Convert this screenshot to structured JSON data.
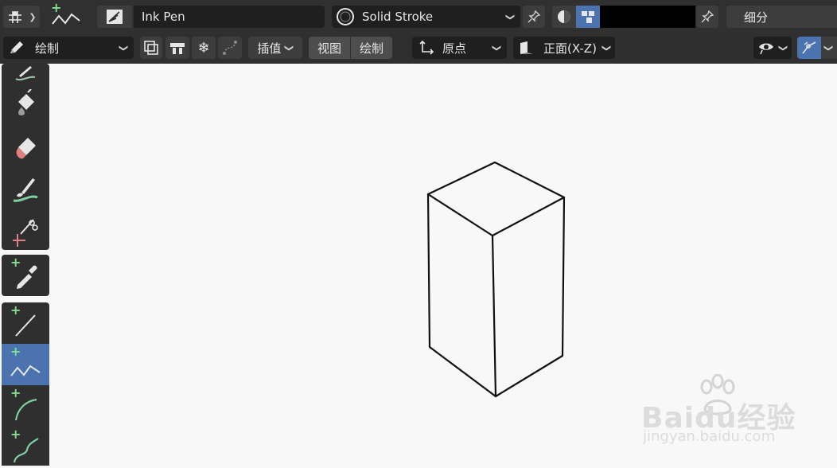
{
  "header": {
    "brush_name": "Ink Pen",
    "material_name": "Solid Stroke",
    "color_value": "",
    "subdivide_label": "细分"
  },
  "toolbar2": {
    "mode_label": "绘制",
    "interpolate_label": "插值",
    "view_label": "视图",
    "draw_label": "绘制",
    "origin_label": "原点",
    "plane_label": "正面(X-Z)"
  },
  "left_tools": [
    {
      "name": "draw-brush"
    },
    {
      "name": "fill"
    },
    {
      "name": "erase"
    },
    {
      "name": "tint"
    },
    {
      "name": "cutter"
    },
    {
      "name": "eyedropper"
    },
    {
      "name": "line"
    },
    {
      "name": "polyline"
    },
    {
      "name": "arc"
    },
    {
      "name": "curve"
    }
  ],
  "colors": {
    "accent": "#4a73b0",
    "plus_green": "#7ee08e",
    "canvas_bg": "#f8f8f8",
    "bar_bg": "#303030"
  },
  "watermark": {
    "brand": "Baidu经验",
    "url": "jingyan.baidu.com"
  }
}
